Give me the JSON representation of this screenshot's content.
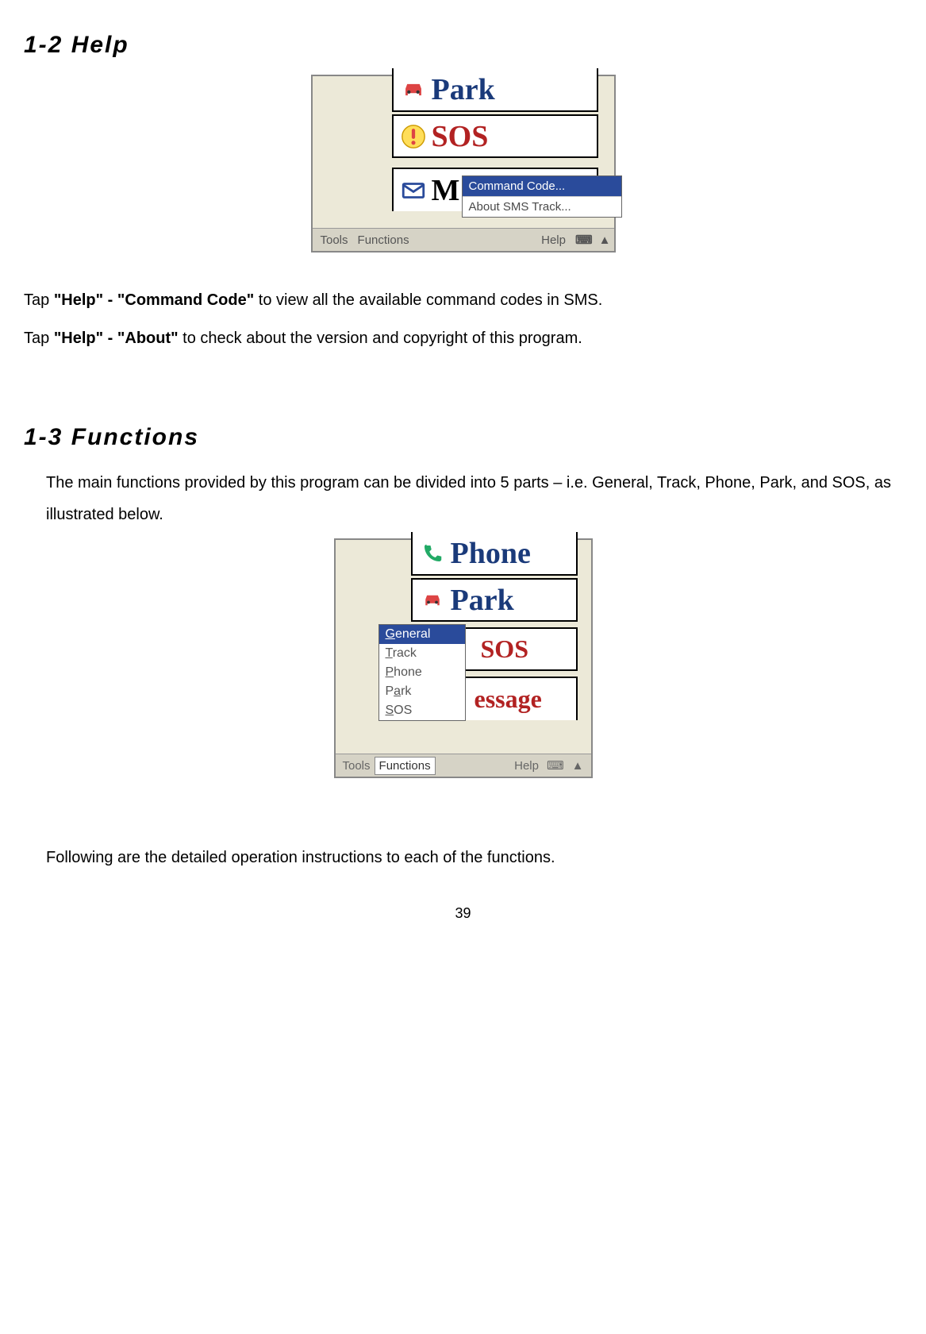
{
  "headings": {
    "h1": "1-2 Help",
    "h2": "1-3 Functions"
  },
  "para1_pre": "Tap ",
  "para1_bold": "\"Help\" - \"Command Code\"",
  "para1_post": " to view all the available command codes in SMS.",
  "para2_pre": "Tap ",
  "para2_bold": "\"Help\" - \"About\"",
  "para2_post": " to check about the version and copyright of this program.",
  "para3": "The main functions provided by this program can be divided into 5 parts – i.e. General, Track, Phone, Park, and SOS, as illustrated below.",
  "para4": "Following are the detailed operation instructions to each of the functions.",
  "page_number": "39",
  "ss1": {
    "park_label": "Park",
    "sos_label": "SOS",
    "msg_prefix": "M",
    "help_menu": {
      "item1": "Command Code...",
      "item2": "About SMS Track..."
    },
    "menubar": {
      "tools": "Tools",
      "functions": "Functions",
      "help": "Help"
    }
  },
  "ss2": {
    "phone_label": "Phone",
    "park_label": "Park",
    "sos_label": "SOS",
    "msg_label": "essage",
    "func_menu": {
      "general": "General",
      "track": "Track",
      "phone": "Phone",
      "park": "Park",
      "sos": "SOS"
    },
    "menubar": {
      "tools": "Tools",
      "functions": "Functions",
      "help": "Help"
    }
  }
}
